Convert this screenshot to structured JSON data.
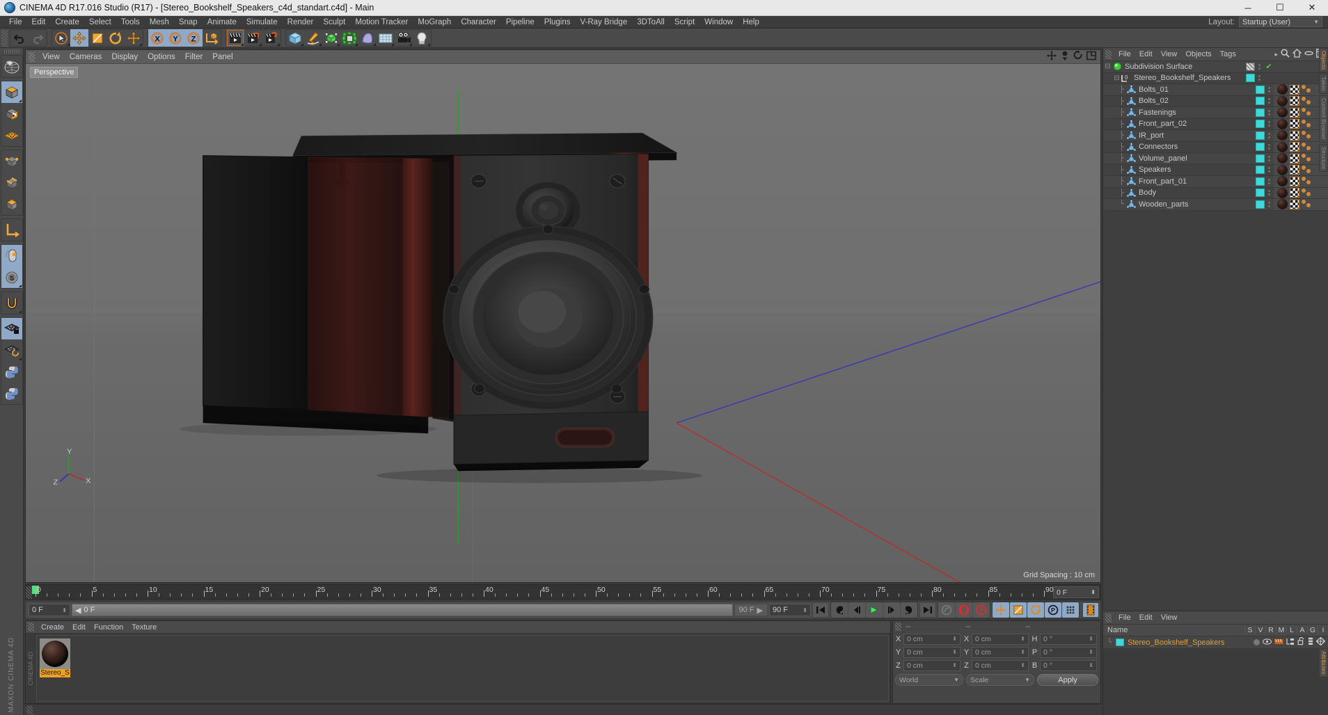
{
  "window": {
    "title": "CINEMA 4D R17.016 Studio (R17) - [Stereo_Bookshelf_Speakers_c4d_standart.c4d] - Main",
    "minimize": "─",
    "maximize": "☐",
    "close": "✕"
  },
  "menubar": {
    "items": [
      "File",
      "Edit",
      "Create",
      "Select",
      "Tools",
      "Mesh",
      "Snap",
      "Animate",
      "Simulate",
      "Render",
      "Sculpt",
      "Motion Tracker",
      "MoGraph",
      "Character",
      "Pipeline",
      "Plugins",
      "V-Ray Bridge",
      "3DToAll",
      "Script",
      "Window",
      "Help"
    ],
    "layout_label": "Layout:",
    "layout_value": "Startup (User)"
  },
  "toolbar": {
    "undo": "undo-arrow",
    "redo": "redo-arrow",
    "select": "live-selection",
    "move": "move-tool",
    "scale": "scale-tool",
    "rotate": "rotate-tool",
    "move2": "move-axis-tool",
    "x_axis": "X",
    "y_axis": "Y",
    "z_axis": "Z",
    "world": "world-coordinates",
    "render_view": "render-view",
    "render_picture": "render-to-picture-viewer",
    "render_settings": "render-settings",
    "cube": "add-cube",
    "spline": "add-spline",
    "generator": "add-generator",
    "deformer": "add-deformer",
    "scene": "add-scene",
    "floor": "add-environment",
    "camera": "add-camera",
    "light": "add-light"
  },
  "left_toolbar": {
    "items": [
      "make-editable",
      "model-mode",
      "texture-mode",
      "points-mode",
      "edges-mode",
      "polygons-mode",
      "axis-mode",
      "object-axis",
      "viewport-solo",
      "enable-snap",
      "workplane-lock",
      "workplane-rotate",
      "python-tag",
      "python-generator"
    ],
    "brand": "MAXON CINEMA 4D"
  },
  "viewport": {
    "menu": [
      "View",
      "Cameras",
      "Display",
      "Options",
      "Filter",
      "Panel"
    ],
    "label": "Perspective",
    "grid_spacing": "Grid Spacing : 10 cm",
    "icons": [
      "move-view-icon",
      "zoom-view-icon",
      "rotate-view-icon",
      "maximize-view-icon"
    ]
  },
  "timeline": {
    "labels": [
      "0",
      "5",
      "10",
      "15",
      "20",
      "25",
      "30",
      "35",
      "40",
      "45",
      "50",
      "55",
      "60",
      "65",
      "70",
      "75",
      "80",
      "85",
      "90"
    ],
    "current_frame": "0 F",
    "end_display": "0 F",
    "range_start": "0 F",
    "range_end_preview": "90 F",
    "range_end": "90 F",
    "play_position": "0 F"
  },
  "transport": {
    "first_frame": "go-to-start-icon",
    "prev_key": "prev-keyframe-icon",
    "prev_frame": "step-back-icon",
    "play": "play-icon",
    "next_frame": "step-forward-icon",
    "next_key": "next-keyframe-icon",
    "last_frame": "go-to-end-icon",
    "autokey": "record-active-objects-icon",
    "record": "record-keyframe-icon",
    "keyselect": "keyframe-selection-icon",
    "pos": "position-keys-icon",
    "scale": "scale-keys-icon",
    "rot": "rotation-keys-icon",
    "param": "param-keys-icon",
    "pla": "point-level-animation-icon",
    "timeline_toggle": "timeline-icon"
  },
  "material_manager": {
    "menu": [
      "Create",
      "Edit",
      "Function",
      "Texture"
    ],
    "materials": [
      {
        "name": "Stereo_S",
        "selected": true
      }
    ],
    "brand": "CINEMA 4D"
  },
  "coordinates": {
    "header_dashes": [
      "--",
      "--",
      "--"
    ],
    "rows": [
      {
        "pos_axis": "X",
        "pos_value": "0 cm",
        "size_axis": "X",
        "size_value": "0 cm",
        "rot_axis": "H",
        "rot_value": "0 °"
      },
      {
        "pos_axis": "Y",
        "pos_value": "0 cm",
        "size_axis": "Y",
        "size_value": "0 cm",
        "rot_axis": "P",
        "rot_value": "0 °"
      },
      {
        "pos_axis": "Z",
        "pos_value": "0 cm",
        "size_axis": "Z",
        "size_value": "0 cm",
        "rot_axis": "B",
        "rot_value": "0 °"
      }
    ],
    "coord_system": "World",
    "size_mode": "Scale",
    "apply": "Apply"
  },
  "object_manager": {
    "menu": [
      "File",
      "Edit",
      "View",
      "Objects",
      "Tags"
    ],
    "overflow": "▸",
    "icons": [
      "search-icon",
      "home-icon",
      "filter-icon",
      "fullscreen-icon"
    ],
    "items": [
      {
        "name": "Subdivision Surface",
        "depth": 0,
        "icon": "subdivision-surface-icon",
        "chip": false,
        "check": true,
        "tags": false
      },
      {
        "name": "Stereo_Bookshelf_Speakers",
        "depth": 1,
        "icon": "null-object-icon",
        "chip": true,
        "check": false,
        "tags": false
      },
      {
        "name": "Bolts_01",
        "depth": 2,
        "icon": "polygon-object-icon",
        "chip": true,
        "check": false,
        "tags": true
      },
      {
        "name": "Bolts_02",
        "depth": 2,
        "icon": "polygon-object-icon",
        "chip": true,
        "check": false,
        "tags": true
      },
      {
        "name": "Fastenings",
        "depth": 2,
        "icon": "polygon-object-icon",
        "chip": true,
        "check": false,
        "tags": true
      },
      {
        "name": "Front_part_02",
        "depth": 2,
        "icon": "polygon-object-icon",
        "chip": true,
        "check": false,
        "tags": true
      },
      {
        "name": "IR_port",
        "depth": 2,
        "icon": "polygon-object-icon",
        "chip": true,
        "check": false,
        "tags": true
      },
      {
        "name": "Connectors",
        "depth": 2,
        "icon": "polygon-object-icon",
        "chip": true,
        "check": false,
        "tags": true
      },
      {
        "name": "Volume_panel",
        "depth": 2,
        "icon": "polygon-object-icon",
        "chip": true,
        "check": false,
        "tags": true
      },
      {
        "name": "Speakers",
        "depth": 2,
        "icon": "polygon-object-icon",
        "chip": true,
        "check": false,
        "tags": true
      },
      {
        "name": "Front_part_01",
        "depth": 2,
        "icon": "polygon-object-icon",
        "chip": true,
        "check": false,
        "tags": true
      },
      {
        "name": "Body",
        "depth": 2,
        "icon": "polygon-object-icon",
        "chip": true,
        "check": false,
        "tags": true
      },
      {
        "name": "Wooden_parts",
        "depth": 2,
        "icon": "polygon-object-icon",
        "chip": true,
        "check": false,
        "tags": true
      }
    ],
    "side_tabs": [
      "Objects",
      "Takes",
      "Content Browser",
      "Structure"
    ]
  },
  "attribute_manager": {
    "menu": [
      "File",
      "Edit",
      "View"
    ],
    "name_header": "Name",
    "columns": [
      "S",
      "V",
      "R",
      "M",
      "L",
      "A",
      "G",
      "I"
    ],
    "rows": [
      {
        "name": "Stereo_Bookshelf_Speakers",
        "selected": true
      }
    ],
    "side_tab": "Attributes"
  },
  "statusbar": {
    "text": ""
  },
  "colors": {
    "accent_orange": "#e09a30",
    "cyan_chip": "#3fd9d9",
    "selection_blue": "#8fa9c9",
    "panel_bg": "#3a3a3a",
    "viewport_bg": "#6e6e6e",
    "red_axis": "#d03030",
    "green_axis": "#30c030",
    "blue_axis": "#4040c8"
  }
}
